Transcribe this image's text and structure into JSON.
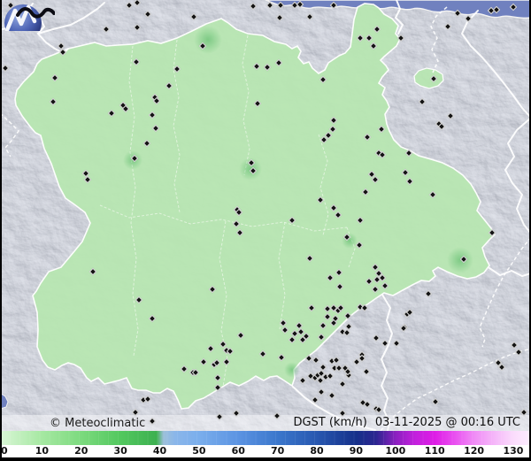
{
  "header": {
    "attribution": "© Meteoclimatic",
    "legend_label": "DGST (km/h)",
    "timestamp": "03-11-2025 @ 00:16 UTC"
  },
  "icons": {
    "logo": "meteoclimatic-globe-logo",
    "marker": "station-diamond-marker"
  },
  "colors": {
    "sea": "#7081bf",
    "terrain_base": "#959cab",
    "region_fill": "#b7e6b0",
    "region_border": "#ffffff",
    "hotspot": "#4db45e",
    "frame": "#000000",
    "tick_strip": "#ffffff"
  },
  "scale": {
    "ticks": [
      "0",
      "10",
      "20",
      "30",
      "40",
      "50",
      "60",
      "70",
      "80",
      "90",
      "100",
      "110",
      "120",
      "130"
    ],
    "tick_values": [
      0,
      10,
      20,
      30,
      40,
      50,
      60,
      70,
      80,
      90,
      100,
      110,
      120,
      130
    ],
    "gradient_stops": [
      [
        0,
        "#d9f6d6"
      ],
      [
        7.9,
        "#a6e8a2"
      ],
      [
        15.3,
        "#7cda7e"
      ],
      [
        22.7,
        "#52c85e"
      ],
      [
        29.5,
        "#3cb050"
      ],
      [
        30.8,
        "#9dc0da"
      ],
      [
        33,
        "#8ab6ea"
      ],
      [
        37.5,
        "#7aaeec"
      ],
      [
        44.9,
        "#5b93e2"
      ],
      [
        52.3,
        "#3b77cc"
      ],
      [
        59.7,
        "#2757b0"
      ],
      [
        67.1,
        "#15308a"
      ],
      [
        70.8,
        "#2b2590"
      ],
      [
        74.5,
        "#8b1fc0"
      ],
      [
        78.2,
        "#c320dd"
      ],
      [
        81.9,
        "#de1ce6"
      ],
      [
        85.6,
        "#e94ff0"
      ],
      [
        89.3,
        "#f08cf6"
      ],
      [
        93,
        "#f5b6f9"
      ],
      [
        96.7,
        "#fbdcfc"
      ],
      [
        100,
        "#fdeeff"
      ]
    ]
  },
  "map": {
    "hotspots": [
      [
        235,
        45,
        16
      ],
      [
        283,
        191,
        13
      ],
      [
        150,
        181,
        11
      ],
      [
        520,
        294,
        15
      ],
      [
        395,
        272,
        9
      ],
      [
        330,
        418,
        9
      ]
    ],
    "markers": [
      [
        12,
        6
      ],
      [
        146,
        6
      ],
      [
        155,
        3
      ],
      [
        167,
        16
      ],
      [
        120,
        33
      ],
      [
        155,
        31
      ],
      [
        69,
        52
      ],
      [
        71,
        59
      ],
      [
        6,
        77
      ],
      [
        62,
        88
      ],
      [
        154,
        70
      ],
      [
        191,
        97
      ],
      [
        60,
        115
      ],
      [
        139,
        119
      ],
      [
        142,
        123
      ],
      [
        126,
        128
      ],
      [
        175,
        110
      ],
      [
        177,
        114
      ],
      [
        172,
        130
      ],
      [
        176,
        145
      ],
      [
        286,
        7
      ],
      [
        305,
        6
      ],
      [
        317,
        6
      ],
      [
        333,
        6
      ],
      [
        339,
        5
      ],
      [
        377,
        6
      ],
      [
        219,
        19
      ],
      [
        316,
        20
      ],
      [
        350,
        19
      ],
      [
        229,
        52
      ],
      [
        200,
        78
      ],
      [
        290,
        75
      ],
      [
        302,
        76
      ],
      [
        315,
        71
      ],
      [
        365,
        90
      ],
      [
        291,
        117
      ],
      [
        377,
        136
      ],
      [
        376,
        146
      ],
      [
        517,
        15
      ],
      [
        529,
        21
      ],
      [
        555,
        12
      ],
      [
        561,
        11
      ],
      [
        580,
        8
      ],
      [
        506,
        30
      ],
      [
        426,
        33
      ],
      [
        453,
        43
      ],
      [
        407,
        43
      ],
      [
        417,
        43
      ],
      [
        422,
        52
      ],
      [
        490,
        89
      ],
      [
        477,
        115
      ],
      [
        509,
        131
      ],
      [
        496,
        140
      ],
      [
        499,
        143
      ],
      [
        431,
        146
      ],
      [
        166,
        162
      ],
      [
        152,
        179
      ],
      [
        97,
        196
      ],
      [
        99,
        203
      ],
      [
        105,
        307
      ],
      [
        371,
        153
      ],
      [
        366,
        158
      ],
      [
        284,
        184
      ],
      [
        286,
        193
      ],
      [
        268,
        237
      ],
      [
        270,
        240
      ],
      [
        267,
        253
      ],
      [
        271,
        263
      ],
      [
        330,
        249
      ],
      [
        362,
        226
      ],
      [
        377,
        235
      ],
      [
        382,
        243
      ],
      [
        392,
        268
      ],
      [
        350,
        292
      ],
      [
        373,
        314
      ],
      [
        383,
        308
      ],
      [
        384,
        324
      ],
      [
        240,
        327
      ],
      [
        415,
        155
      ],
      [
        428,
        173
      ],
      [
        432,
        175
      ],
      [
        462,
        173
      ],
      [
        420,
        197
      ],
      [
        424,
        203
      ],
      [
        413,
        217
      ],
      [
        458,
        195
      ],
      [
        463,
        205
      ],
      [
        489,
        220
      ],
      [
        407,
        249
      ],
      [
        406,
        277
      ],
      [
        556,
        263
      ],
      [
        524,
        293
      ],
      [
        424,
        302
      ],
      [
        428,
        309
      ],
      [
        417,
        318
      ],
      [
        426,
        316
      ],
      [
        432,
        314
      ],
      [
        435,
        323
      ],
      [
        424,
        327
      ],
      [
        157,
        339
      ],
      [
        172,
        360
      ],
      [
        238,
        394
      ],
      [
        252,
        389
      ],
      [
        256,
        396
      ],
      [
        260,
        397
      ],
      [
        230,
        409
      ],
      [
        242,
        412
      ],
      [
        245,
        410
      ],
      [
        256,
        409
      ],
      [
        208,
        417
      ],
      [
        218,
        421
      ],
      [
        221,
        421
      ],
      [
        246,
        427
      ],
      [
        246,
        438
      ],
      [
        272,
        379
      ],
      [
        297,
        400
      ],
      [
        320,
        365
      ],
      [
        322,
        373
      ],
      [
        318,
        404
      ],
      [
        162,
        452
      ],
      [
        167,
        451
      ],
      [
        153,
        466
      ],
      [
        172,
        476
      ],
      [
        248,
        471
      ],
      [
        267,
        467
      ],
      [
        313,
        470
      ],
      [
        352,
        348
      ],
      [
        370,
        349
      ],
      [
        377,
        348
      ],
      [
        382,
        351
      ],
      [
        385,
        348
      ],
      [
        407,
        347
      ],
      [
        412,
        348
      ],
      [
        370,
        358
      ],
      [
        379,
        360
      ],
      [
        393,
        357
      ],
      [
        460,
        355
      ],
      [
        338,
        368
      ],
      [
        365,
        368
      ],
      [
        377,
        365
      ],
      [
        394,
        369
      ],
      [
        457,
        370
      ],
      [
        333,
        377
      ],
      [
        340,
        375
      ],
      [
        346,
        380
      ],
      [
        363,
        381
      ],
      [
        387,
        375
      ],
      [
        392,
        376
      ],
      [
        425,
        382
      ],
      [
        435,
        388
      ],
      [
        448,
        388
      ],
      [
        330,
        384
      ],
      [
        342,
        384
      ],
      [
        409,
        401
      ],
      [
        409,
        405
      ],
      [
        349,
        405
      ],
      [
        357,
        407
      ],
      [
        375,
        408
      ],
      [
        380,
        407
      ],
      [
        365,
        415
      ],
      [
        378,
        416
      ],
      [
        383,
        416
      ],
      [
        390,
        416
      ],
      [
        403,
        409
      ],
      [
        414,
        420
      ],
      [
        351,
        425
      ],
      [
        356,
        427
      ],
      [
        359,
        424
      ],
      [
        363,
        422
      ],
      [
        368,
        426
      ],
      [
        373,
        425
      ],
      [
        362,
        430
      ],
      [
        394,
        424
      ],
      [
        393,
        420
      ],
      [
        342,
        430
      ],
      [
        363,
        443
      ],
      [
        375,
        447
      ],
      [
        356,
        452
      ],
      [
        387,
        434
      ],
      [
        410,
        455
      ],
      [
        415,
        457
      ],
      [
        425,
        462
      ],
      [
        428,
        463
      ],
      [
        484,
        332
      ],
      [
        463,
        353
      ],
      [
        456,
        371
      ],
      [
        581,
        390
      ],
      [
        586,
        398
      ],
      [
        563,
        410
      ],
      [
        567,
        415
      ],
      [
        492,
        454
      ],
      [
        592,
        466
      ],
      [
        387,
        467
      ]
    ]
  }
}
